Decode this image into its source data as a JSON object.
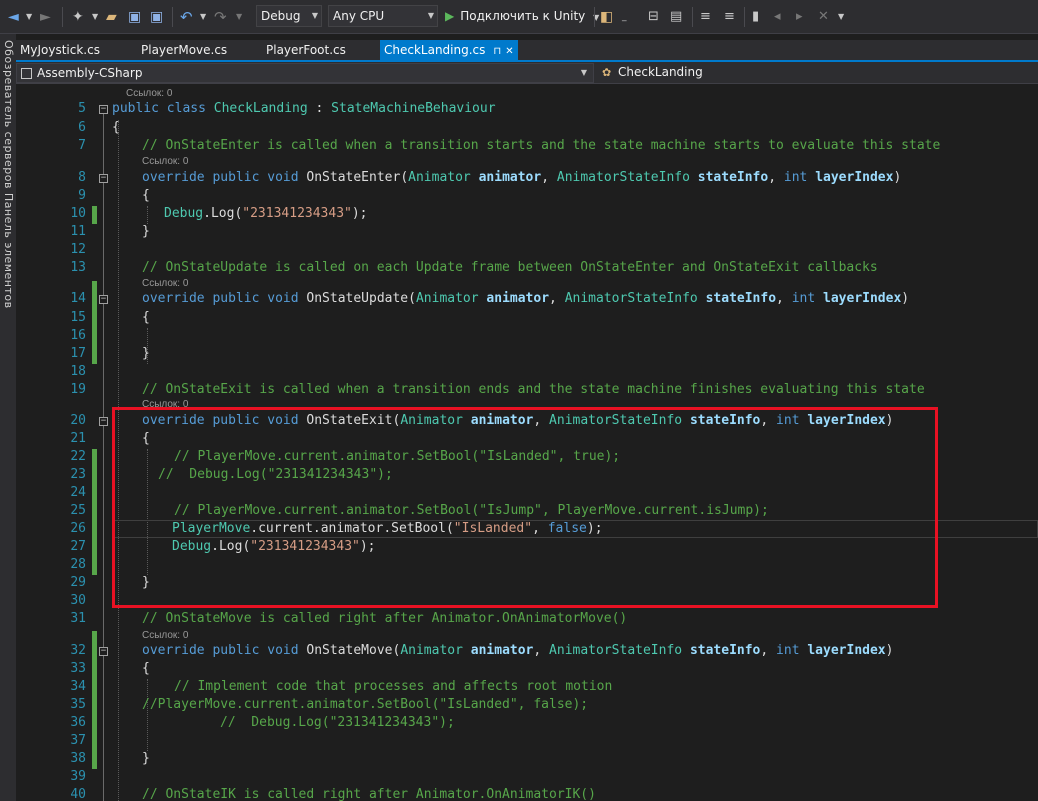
{
  "toolbar": {
    "configuration": "Debug",
    "platform": "Any CPU",
    "attach_label": "Подключить к Unity"
  },
  "tabs": [
    {
      "label": "MyJoystick.cs"
    },
    {
      "label": "PlayerMove.cs"
    },
    {
      "label": "PlayerFoot.cs"
    },
    {
      "label": "CheckLanding.cs"
    }
  ],
  "left_strip": {
    "text": "Обозреватель серверов   Панель элементов"
  },
  "navbar": {
    "project": "Assembly-CSharp",
    "member": "CheckLanding"
  },
  "editor": {
    "lens_label": "Ссылок: 0",
    "lines": [
      {
        "n": "5"
      },
      {
        "n": "6"
      },
      {
        "n": "7"
      },
      {
        "n": "8"
      },
      {
        "n": "9"
      },
      {
        "n": "10"
      },
      {
        "n": "11"
      },
      {
        "n": "12"
      },
      {
        "n": "13"
      },
      {
        "n": "14"
      },
      {
        "n": "15"
      },
      {
        "n": "16"
      },
      {
        "n": "17"
      },
      {
        "n": "18"
      },
      {
        "n": "19"
      },
      {
        "n": "20"
      },
      {
        "n": "21"
      },
      {
        "n": "22"
      },
      {
        "n": "23"
      },
      {
        "n": "24"
      },
      {
        "n": "25"
      },
      {
        "n": "26"
      },
      {
        "n": "27"
      },
      {
        "n": "28"
      },
      {
        "n": "29"
      },
      {
        "n": "30"
      },
      {
        "n": "31"
      },
      {
        "n": "32"
      },
      {
        "n": "33"
      },
      {
        "n": "34"
      },
      {
        "n": "35"
      },
      {
        "n": "36"
      },
      {
        "n": "37"
      },
      {
        "n": "38"
      },
      {
        "n": "39"
      },
      {
        "n": "40"
      }
    ],
    "t": {
      "public": "public",
      "class": "class",
      "override": "override",
      "void": "void",
      "int": "int",
      "false": "false",
      "CheckLanding": "CheckLanding",
      "StateMachineBehaviour": "StateMachineBehaviour",
      "Animator": "Animator",
      "AnimatorStateInfo": "AnimatorStateInfo",
      "animator": "animator",
      "stateInfo": "stateInfo",
      "layerIndex": "layerIndex",
      "OnStateEnter": "OnStateEnter",
      "OnStateUpdate": "OnStateUpdate",
      "OnStateExit": "OnStateExit",
      "OnStateMove": "OnStateMove",
      "Debug": "Debug",
      "Log": "Log",
      "PlayerMove": "PlayerMove",
      "SetBool": "SetBool",
      "s_num": "\"231341234343\"",
      "s_landed": "\"IsLanded\"",
      "current_animator": ".current.animator.",
      "c7": "// OnStateEnter is called when a transition starts and the state machine starts to evaluate this state",
      "c13": "// OnStateUpdate is called on each Update frame between OnStateEnter and OnStateExit callbacks",
      "c19": "// OnStateExit is called when a transition ends and the state machine finishes evaluating this state",
      "c22": "// PlayerMove.current.animator.SetBool(\"IsLanded\", true);",
      "c23": "//  Debug.Log(\"231341234343\");",
      "c25": "// PlayerMove.current.animator.SetBool(\"IsJump\", PlayerMove.current.isJump);",
      "c31": "// OnStateMove is called right after Animator.OnAnimatorMove()",
      "c34": "// Implement code that processes and affects root motion",
      "c35": "//PlayerMove.current.animator.SetBool(\"IsLanded\", false);",
      "c36": "//  Debug.Log(\"231341234343\");",
      "c40": "// OnStateIK is called right after Animator.OnAnimatorIK()"
    }
  }
}
